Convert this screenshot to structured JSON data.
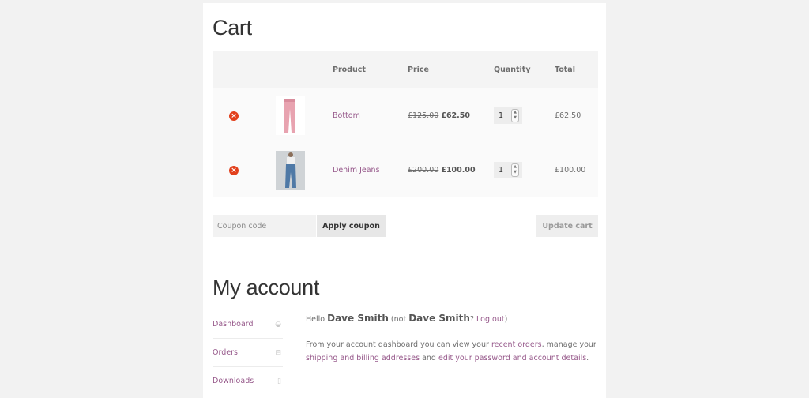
{
  "cart": {
    "title": "Cart",
    "columns": [
      "",
      "",
      "Product",
      "Price",
      "Quantity",
      "Total"
    ],
    "items": [
      {
        "name": "Bottom",
        "old_price": "£125.00",
        "price": "£62.50",
        "quantity": "1",
        "total": "£62.50",
        "image": "pink-trousers"
      },
      {
        "name": "Denim Jeans",
        "old_price": "£200.00",
        "price": "£100.00",
        "quantity": "1",
        "total": "£100.00",
        "image": "denim-jeans"
      }
    ],
    "coupon_placeholder": "Coupon code",
    "apply_coupon_label": "Apply coupon",
    "update_cart_label": "Update cart",
    "remove_icon": "×"
  },
  "account": {
    "title": "My account",
    "nav": [
      {
        "label": "Dashboard",
        "icon": "dashboard-icon"
      },
      {
        "label": "Orders",
        "icon": "basket-icon"
      },
      {
        "label": "Downloads",
        "icon": "file-icon"
      }
    ],
    "hello": "Hello",
    "user_name": "Dave Smith",
    "not_open": "(not",
    "not_name": "Dave Smith",
    "q": "?",
    "logout_label": "Log out",
    "close_paren": ")",
    "intro_1": "From your account dashboard you can view your",
    "recent_orders_label": "recent orders",
    "intro_2": ", manage your",
    "addresses_label": "shipping and billing addresses",
    "intro_3": "and",
    "password_label": "edit your password and account details",
    "intro_4": "."
  },
  "colors": {
    "link": "#96588a",
    "remove": "#e2401c",
    "heading": "#333333"
  }
}
